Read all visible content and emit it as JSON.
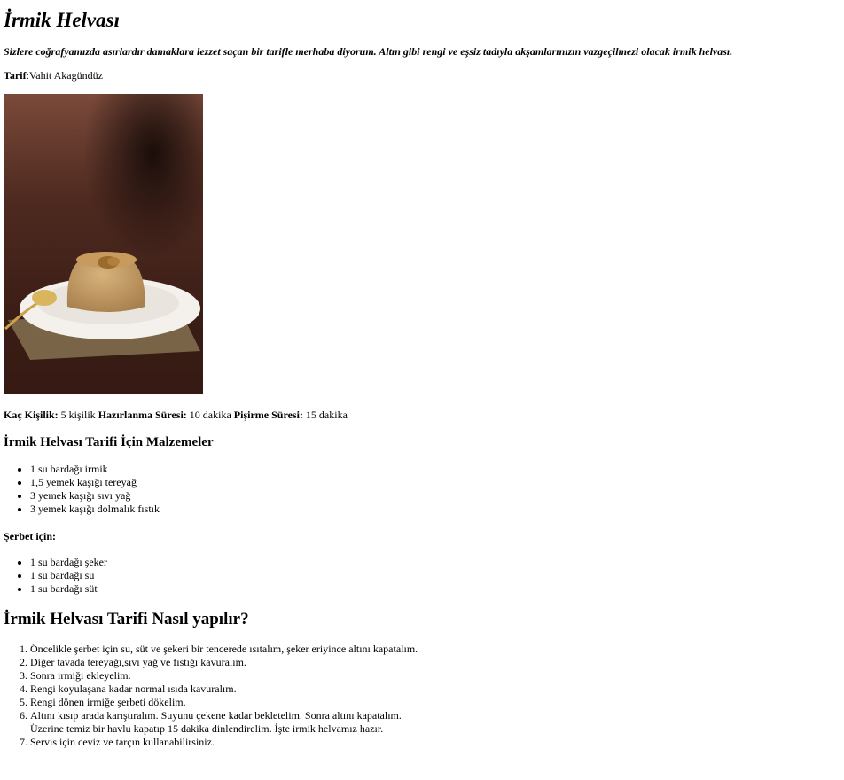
{
  "title": "İrmik Helvası",
  "intro": "Sizlere coğrafyamızda asırlardır damaklara lezzet saçan bir tarifle merhaba diyorum. Altın gibi rengi ve eşsiz tadıyla akşamlarınızın vazgeçilmezi olacak irmik helvası.",
  "author": {
    "label": "Tarif",
    "name": "Vahit Akagündüz"
  },
  "meta": {
    "servings_label": "Kaç Kişilik:",
    "servings_value": "5 kişilik",
    "prep_label": "Hazırlanma Süresi:",
    "prep_value": "10 dakika",
    "cook_label": "Pişirme Süresi:",
    "cook_value": "15 dakika"
  },
  "ingredients_heading": "İrmik Helvası Tarifi İçin Malzemeler",
  "ingredients": [
    "1 su bardağı irmik",
    "1,5 yemek kaşığı tereyağ",
    "3 yemek kaşığı sıvı yağ",
    "3 yemek kaşığı dolmalık fıstık"
  ],
  "sherbet_heading": "Şerbet için:",
  "sherbet": [
    "1 su bardağı şeker",
    "1 su bardağı su",
    "1 su bardağı süt"
  ],
  "steps_heading": "İrmik Helvası Tarifi Nasıl yapılır?",
  "steps": [
    "Öncelikle şerbet için su, süt ve şekeri bir tencerede ısıtalım, şeker eriyince altını kapatalım.",
    "Diğer tavada tereyağı,sıvı yağ ve fıstığı kavuralım.",
    "Sonra irmiği ekleyelim.",
    "Rengi koyulaşana kadar normal ısıda kavuralım.",
    "Rengi dönen irmiğe şerbeti dökelim.",
    "Altını kısıp arada karıştıralım. Suyunu çekene kadar bekletelim. Sonra altını kapatalım. Üzerine temiz bir havlu kapatıp 15 dakika dinlendirelim. İşte irmik helvamız hazır.",
    "Servis için ceviz ve tarçın kullanabilirsiniz."
  ]
}
